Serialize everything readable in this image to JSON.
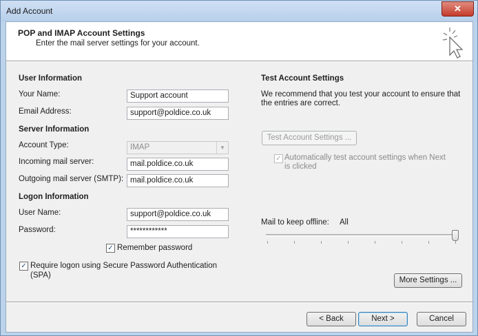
{
  "window": {
    "title": "Add Account",
    "close_glyph": "✕"
  },
  "header": {
    "title": "POP and IMAP Account Settings",
    "subtitle": "Enter the mail server settings for your account.",
    "icon": "cursor-click-icon"
  },
  "user_info": {
    "heading": "User Information",
    "name_label": "Your Name:",
    "name_value": "Support account",
    "email_label": "Email Address:",
    "email_value": "support@poldice.co.uk"
  },
  "server_info": {
    "heading": "Server Information",
    "account_type_label": "Account Type:",
    "account_type_value": "IMAP",
    "incoming_label": "Incoming mail server:",
    "incoming_value": "mail.poldice.co.uk",
    "outgoing_label": "Outgoing mail server (SMTP):",
    "outgoing_value": "mail.poldice.co.uk"
  },
  "logon_info": {
    "heading": "Logon Information",
    "username_label": "User Name:",
    "username_value": "support@poldice.co.uk",
    "password_label": "Password:",
    "password_value": "************",
    "remember_label": "Remember password",
    "remember_checked": true,
    "spa_label_line1": "Require logon using Secure Password Authentication",
    "spa_label_line2": "(SPA)",
    "spa_checked": true
  },
  "test_settings": {
    "heading": "Test Account Settings",
    "desc_line1": "We recommend that you test your account to ensure that",
    "desc_line2": "the entries are correct.",
    "test_button": "Test Account Settings ...",
    "auto_test_line1": "Automatically test account settings when Next",
    "auto_test_line2": "is clicked",
    "auto_test_checked": true
  },
  "offline": {
    "label": "Mail to keep offline:",
    "value": "All",
    "slider_level": 1.0
  },
  "more_settings_button": "More Settings ...",
  "footer": {
    "back_button": "< Back",
    "next_button": "Next >",
    "cancel_button": "Cancel"
  },
  "check_glyph": "✓"
}
